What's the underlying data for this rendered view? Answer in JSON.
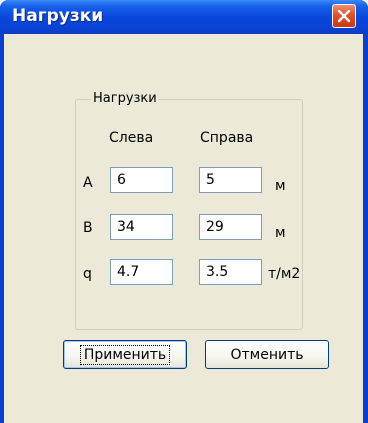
{
  "window": {
    "title": "Нагрузки"
  },
  "group": {
    "legend": "Нагрузки"
  },
  "columns": {
    "left": "Слева",
    "right": "Справа"
  },
  "rows": [
    {
      "label": "A",
      "left": "6",
      "right": "5",
      "unit": "м"
    },
    {
      "label": "B",
      "left": "34",
      "right": "29",
      "unit": "м"
    },
    {
      "label": "q",
      "left": "4.7",
      "right": "3.5",
      "unit": "т/м2"
    }
  ],
  "buttons": {
    "apply": "Применить",
    "cancel": "Отменить"
  },
  "icons": {
    "close": "close-icon"
  },
  "colors": {
    "titlebar": "#0a48dc",
    "close_button": "#e0502a",
    "client": "#ece9d8"
  }
}
